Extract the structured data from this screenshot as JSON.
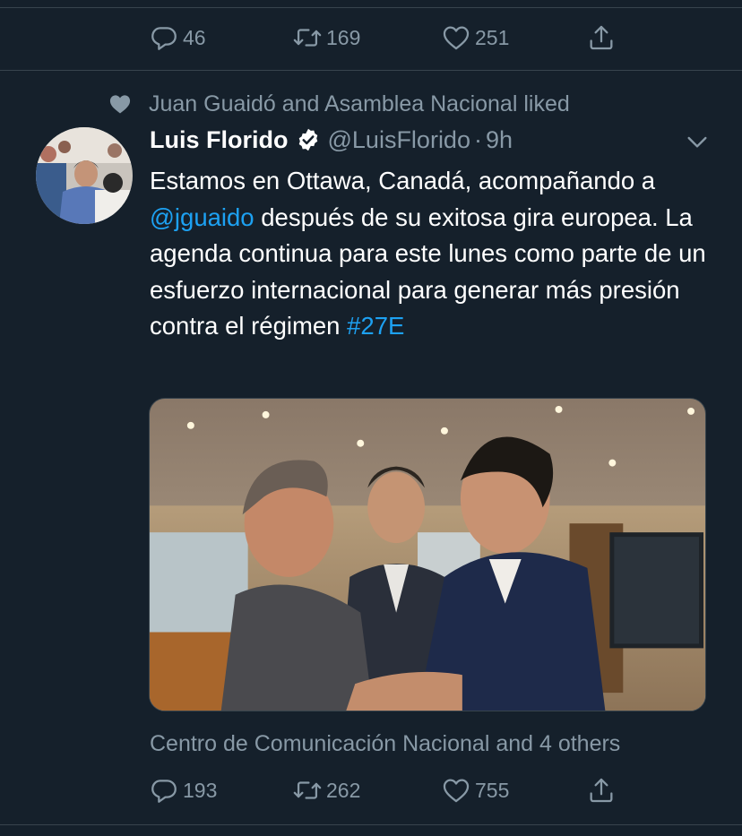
{
  "prev_tweet": {
    "actions": {
      "replies": "46",
      "retweets": "169",
      "likes": "251"
    }
  },
  "tweet": {
    "social_context": "Juan Guaidó and Asamblea Nacional liked",
    "author_name": "Luis Florido",
    "author_handle": "@LuisFlorido",
    "separator": "·",
    "time": "9h",
    "text_1": "Estamos en Ottawa, Canadá, acompañando a ",
    "mention": "@jguaido",
    "text_2": " después de su exitosa gira europea. La agenda continua para este lunes como parte de un esfuerzo internacional para generar más presión contra el régimen ",
    "hashtag": "#27E",
    "likers": "Centro de Comunicación Nacional and 4 others",
    "actions": {
      "replies": "193",
      "retweets": "262",
      "likes": "755"
    }
  },
  "icons": {
    "reply": "reply-icon",
    "retweet": "retweet-icon",
    "like": "heart-icon",
    "share": "share-icon",
    "verified": "verified-badge-icon",
    "caret": "chevron-down-icon"
  },
  "colors": {
    "background": "#15202b",
    "divider": "#38444d",
    "secondary_text": "#8899a6",
    "link": "#1da1f2"
  }
}
